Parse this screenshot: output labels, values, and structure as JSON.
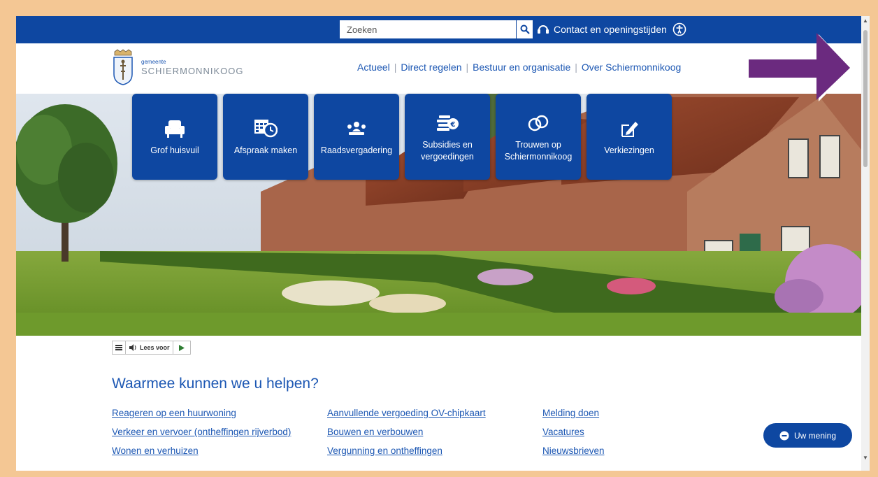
{
  "colors": {
    "brand": "#0e47a1",
    "link": "#1c57b3",
    "frame": "#f4c794",
    "annotation_arrow": "#6b2a7f"
  },
  "search": {
    "placeholder": "Zoeken"
  },
  "topbar": {
    "contact_label": "Contact en openingstijden"
  },
  "logo": {
    "small": "gemeente",
    "big": "SCHIERMONNIKOOG"
  },
  "nav": {
    "items": [
      "Actueel",
      "Direct regelen",
      "Bestuur en organisatie",
      "Over Schiermonnikoog"
    ]
  },
  "tiles": [
    {
      "label": "Grof huisvuil",
      "icon": "armchair-icon"
    },
    {
      "label": "Afspraak maken",
      "icon": "calendar-clock-icon"
    },
    {
      "label": "Raadsvergadering",
      "icon": "meeting-icon"
    },
    {
      "label": "Subsidies en vergoedingen",
      "icon": "coins-icon"
    },
    {
      "label": "Trouwen op Schiermonnikoog",
      "icon": "rings-icon"
    },
    {
      "label": "Verkiezingen",
      "icon": "pencil-icon"
    }
  ],
  "readspeaker": {
    "label": "Lees voor"
  },
  "help": {
    "title": "Waarmee kunnen we u helpen?",
    "columns": [
      [
        "Reageren op een huurwoning",
        "Verkeer en vervoer (ontheffingen rijverbod)",
        "Wonen en verhuizen"
      ],
      [
        "Aanvullende vergoeding OV-chipkaart",
        "Bouwen en verbouwen",
        "Vergunning en ontheffingen"
      ],
      [
        "Melding doen",
        "Vacatures",
        "Nieuwsbrieven"
      ]
    ]
  },
  "feedback": {
    "label": "Uw mening"
  }
}
